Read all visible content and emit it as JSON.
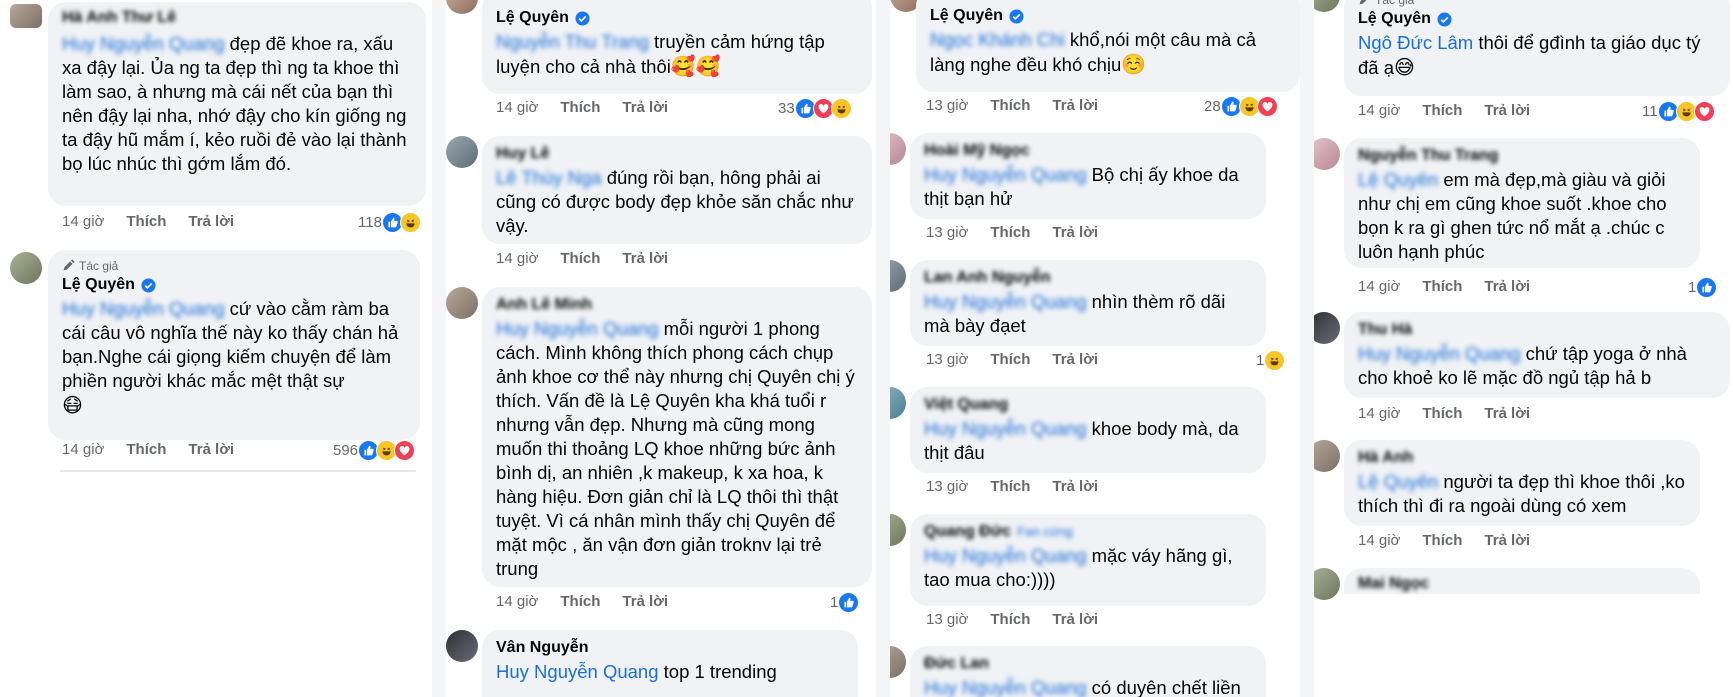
{
  "labels": {
    "author": "Tác giả",
    "like": "Thích",
    "reply": "Trả lời"
  },
  "col1": {
    "c1": {
      "name": "Hà Anh Thư Lê",
      "mention": "Huy Nguyễn Quang",
      "text": " đẹp đẽ khoe ra, xấu xa đậy lại. Ủa ng ta đẹp thì ng ta khoe thì làm sao, à nhưng mà cái nết của bạn thì nên đậy lại nha, nhớ đậy cho kín giống ng ta đậy hũ mắm í, kẻo ruồi đẻ vào lại thành bọ lúc nhúc thì gớm lắm đó.",
      "time": "14 giờ",
      "count": "118"
    },
    "c2": {
      "name": "Lệ Quyên",
      "mention": "Huy Nguyễn Quang",
      "text": " cứ vào cằm ràm ba cái câu vô nghĩa thế này ko thấy chán hả bạn.Nghe cái giọng kiếm chuyện để làm phiền người khác mắc mệt thật sự",
      "emoji": "😷",
      "time": "14 giờ",
      "count": "596"
    }
  },
  "col2": {
    "c1": {
      "name": "Lệ Quyên",
      "mention": "Nguyễn Thu Trang",
      "text": " truyền cảm hứng tập luyện cho cả nhà thôi",
      "emoji": "🥰🥰",
      "time": "14 giờ",
      "count": "33"
    },
    "c2": {
      "name": "Huy Lê",
      "mention": "Lê Thùy Nga",
      "text": " đúng rồi bạn, hông phải ai cũng có được body đẹp khỏe săn chắc như vậy.",
      "time": "14 giờ"
    },
    "c3": {
      "name": "Anh Lê Minh",
      "mention": "Huy Nguyễn Quang",
      "text": " mỗi người 1 phong cách. Mình không thích phong cách chụp ảnh khoe cơ thể này nhưng chị Quyên chị ý thích. Vấn đề là Lệ Quyên kha khá tuổi r nhưng vẫn đẹp. Nhưng mà cũng mong muốn thi thoảng LQ khoe những bức ảnh bình dị, an nhiên ,k makeup, k xa hoa, k hàng hiệu. Đơn giản chỉ là LQ thôi thì thật tuyệt. Vì cá nhân mình thấy chị Quyên để mặt mộc , ăn vận đơn giản troknv lại trẻ trung",
      "time": "14 giờ",
      "count": "1"
    },
    "c4": {
      "name": "Vân Nguyễn",
      "mention": "Huy Nguyễn Quang",
      "text": " top 1 trending"
    }
  },
  "col3": {
    "c1": {
      "name": "Lệ Quyên",
      "mention": "Ngọc Khánh Chi",
      "text": " khổ,nói một câu mà cả làng nghe đều khó chịu",
      "emoji": "☺️",
      "time": "13 giờ",
      "count": "28"
    },
    "c2": {
      "name": "Hoài Mỹ Ngọc",
      "mention": "Huy Nguyễn Quang",
      "text": " Bộ chị ấy khoe da thịt bạn hử",
      "time": "13 giờ"
    },
    "c3": {
      "name": "Lan Anh Nguyễn",
      "mention": "Huy Nguyễn Quang",
      "text": " nhìn thèm rõ dãi mà bày đạet",
      "time": "13 giờ",
      "count": "1"
    },
    "c4": {
      "name": "Việt Quang",
      "mention": "Huy Nguyễn Quang",
      "text": " khoe body mà, da thịt đâu",
      "time": "13 giờ"
    },
    "c5": {
      "name": "Quang Đức",
      "fan": "Fan cứng",
      "mention": "Huy Nguyễn Quang",
      "text": " mặc váy hãng gì, tao mua cho:))))",
      "time": "13 giờ"
    },
    "c6": {
      "name": "Đức Lan",
      "mention": "Huy Nguyễn Quang",
      "text": " có duyên chết liền"
    }
  },
  "col4": {
    "c1": {
      "name": "Lệ Quyên",
      "mention": "Ngô Đức Lâm",
      "text": " thôi để gđình ta giáo dục tý đã ạ",
      "emoji": "😅",
      "time": "14 giờ",
      "count": "11"
    },
    "c2": {
      "name": "Nguyễn Thu Trang",
      "mention": "Lệ Quyên",
      "text": " em mà đẹp,mà giàu và giỏi như chị em cũng khoe suốt .khoe cho bọn k ra gì ghen tức nổ mắt ạ .chúc c luôn hạnh phúc",
      "time": "14 giờ",
      "count": "1"
    },
    "c3": {
      "name": "Thu Hà",
      "mention": "Huy Nguyễn Quang",
      "text": " chứ tập yoga ở nhà cho khoẻ ko lẽ mặc đồ ngủ tập hả b",
      "time": "14 giờ"
    },
    "c4": {
      "name": "Hà Anh",
      "mention": "Lệ Quyên",
      "text": " người ta đẹp thì khoe thôi ,ko thích thì đi ra ngoài dùng có xem",
      "time": "14 giờ"
    },
    "c5": {
      "name": "Mai Ngọc"
    }
  }
}
